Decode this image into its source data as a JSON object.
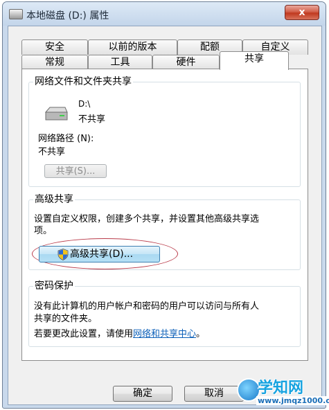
{
  "window": {
    "title": "本地磁盘 (D:) 属性",
    "close_label": "x"
  },
  "tabs": {
    "top_row": [
      "安全",
      "以前的版本",
      "配额",
      "自定义"
    ],
    "bottom_row": [
      "常规",
      "工具",
      "硬件",
      "共享"
    ],
    "active": "共享"
  },
  "network_sharing": {
    "legend": "网络文件和文件夹共享",
    "drive_path": "D:\\",
    "status": "不共享",
    "network_path_label": "网络路径 (N):",
    "network_path_value": "不共享",
    "share_button": "共享(S)..."
  },
  "advanced_sharing": {
    "legend": "高级共享",
    "description_line1": "设置自定义权限，创建多个共享，并设置其他高级共享选",
    "description_line2": "项。",
    "button": "高级共享(D)..."
  },
  "password_protection": {
    "legend": "密码保护",
    "description_line1": "没有此计算机的用户帐户和密码的用户可以访问与所有人",
    "description_line2": "共享的文件夹。",
    "change_prefix": "若要更改此设置，请使用",
    "change_link": "网络和共享中心",
    "change_suffix": "。"
  },
  "footer": {
    "ok": "确定",
    "cancel": "取消"
  },
  "watermark": {
    "text": "学知网",
    "url": "www.jmqz1000.com"
  }
}
